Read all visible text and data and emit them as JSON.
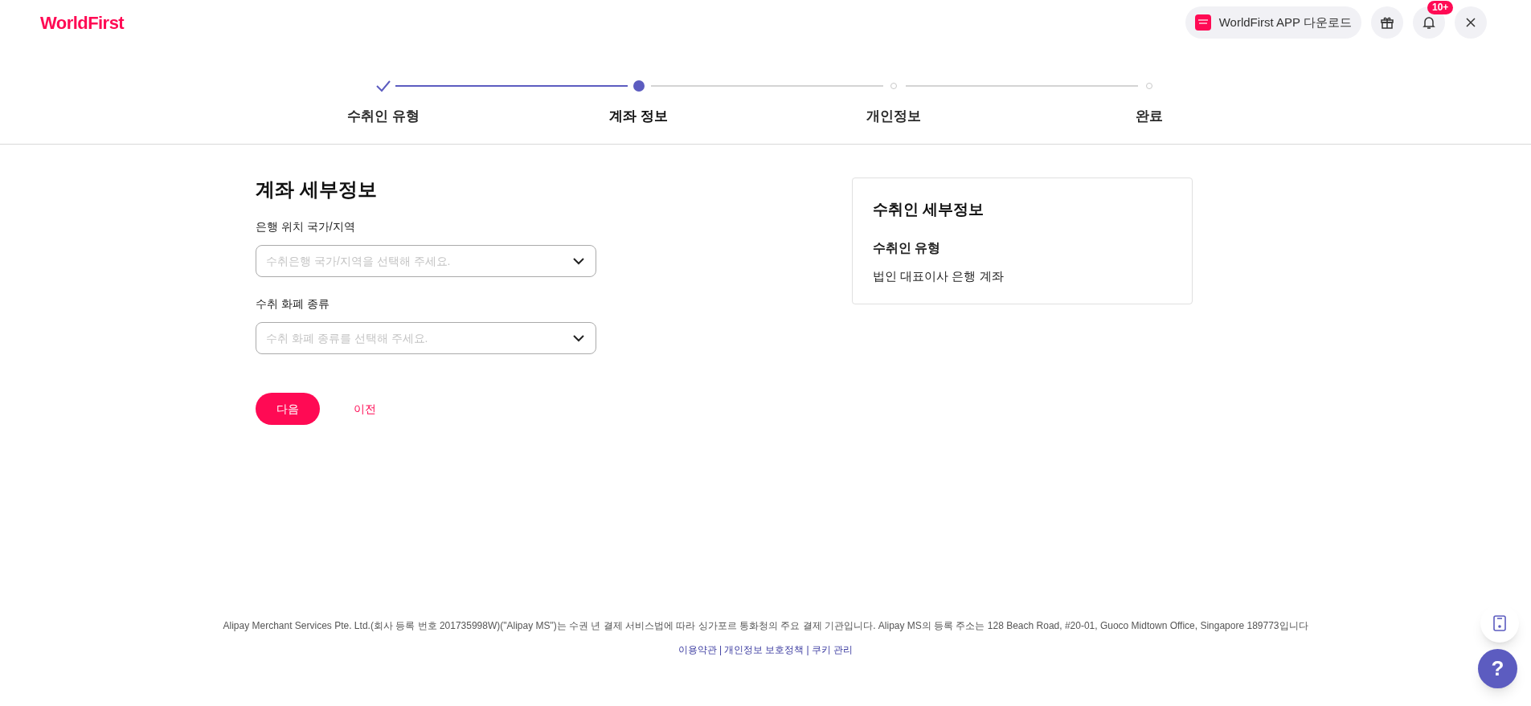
{
  "header": {
    "logo": "WorldFirst",
    "app_download": {
      "label": "WorldFirst APP 다운로드"
    },
    "notification_badge": "10+"
  },
  "steps": [
    {
      "label": "수취인 유형",
      "completed": true,
      "selected": false
    },
    {
      "label": "계좌 정보",
      "completed": false,
      "selected": true
    },
    {
      "label": "개인정보",
      "completed": false,
      "selected": false
    },
    {
      "label": "완료",
      "completed": false,
      "selected": false
    }
  ],
  "form": {
    "title": "계좌 세부정보",
    "fields": [
      {
        "label": "은행 위치 국가/지역",
        "placeholder": "수취은행 국가/지역을 선택해 주세요."
      },
      {
        "label": "수취 화폐 종류",
        "placeholder": "수취 화폐 종류를 선택해 주세요."
      }
    ],
    "next_button": "다음",
    "back_link": "이전"
  },
  "summary_card": {
    "title": "수취인 세부정보",
    "items": [
      {
        "label": "수취인 유형",
        "value": "법인 대표이사 은행 계좌"
      }
    ]
  },
  "footer": {
    "text": "Alipay Merchant Services Pte. Ltd.(회사 등록 번호 201735998W)(\"Alipay MS\")는 수권 년 결제 서비스법에 따라 싱가포르 통화청의 주요 결제 기관입니다. Alipay MS의 등록 주소는 128 Beach Road, #20-01, Guoco Midtown Office, Singapore 189773입니다",
    "links": [
      "이용약관",
      "개인정보 보호정책",
      "쿠키 관리"
    ],
    "separators": [
      "|",
      "|"
    ]
  },
  "help_button": "?"
}
